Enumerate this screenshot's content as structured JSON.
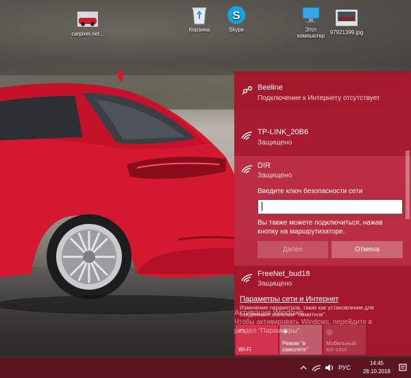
{
  "desktop": {
    "icons": [
      {
        "label": "carpixel.net..."
      },
      {
        "label": "Корзина"
      },
      {
        "label": "Skype"
      },
      {
        "label": "Этот компьютер"
      },
      {
        "label": "97921399.jpg"
      }
    ]
  },
  "flyout": {
    "networks": [
      {
        "name": "Beeline",
        "status": "Подключение к Интернету отсутствует"
      },
      {
        "name": "TP-LINK_20B6",
        "status": "Защищено"
      },
      {
        "name": "DIR",
        "status": "Защищено"
      },
      {
        "name": "FreeNet_bud18",
        "status": "Защищено"
      }
    ],
    "key_prompt": "Введите ключ безопасности сети",
    "key_value": "",
    "hint": "Вы также можете подключиться, нажав кнопку на маршрутизаторе.",
    "next_label": "Далее",
    "cancel_label": "Отмена",
    "settings_link": "Параметры сети и Интернет",
    "settings_desc": "Изменение параметров, таких как установление для соединения значения \"лимитное\".",
    "tiles": {
      "wifi": "Wi-Fi",
      "airplane": "Режим \"в самолете\"",
      "hotspot": "Мобильный хот-спот"
    },
    "watermark_line1": "Активация Windows",
    "watermark_line2": "Чтобы активировать Windows, перейдите в",
    "watermark_line3": "раздел \"Параметры\"."
  },
  "taskbar": {
    "language": "РУС",
    "time": "14:45",
    "date": "28.10.2018"
  },
  "colors": {
    "accent": "#a8162c",
    "tile_active": "#d3334f",
    "taskbar": "#5a1521"
  }
}
